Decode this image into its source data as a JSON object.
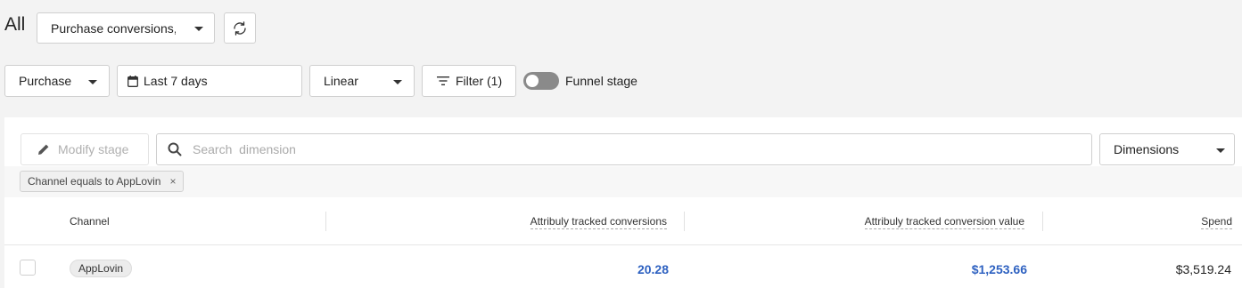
{
  "header": {
    "title": "All",
    "metric_select": "Purchase conversions, by",
    "refresh_icon": "refresh-icon"
  },
  "toolbar": {
    "event_select": "Purchase",
    "date_range": "Last 7 days",
    "model_select": "Linear",
    "filter_label": "Filter (1)",
    "funnel_toggle_label": "Funnel stage",
    "funnel_toggle_on": false
  },
  "panel": {
    "modify_stage_label": "Modify stage",
    "search_placeholder": "Search  dimension",
    "dimensions_label": "Dimensions",
    "active_filter_chip": "Channel equals to AppLovin"
  },
  "table": {
    "columns": [
      "Channel",
      "Attribuly tracked conversions",
      "Attribuly tracked conversion value",
      "Spend"
    ],
    "rows": [
      {
        "channel": "AppLovin",
        "conversions": "20.28",
        "conversion_value": "$1,253.66",
        "spend": "$3,519.24"
      }
    ]
  },
  "colors": {
    "accent": "#2f62c1",
    "background": "#f3f3f3",
    "toggle_off": "#8a8a8a"
  }
}
